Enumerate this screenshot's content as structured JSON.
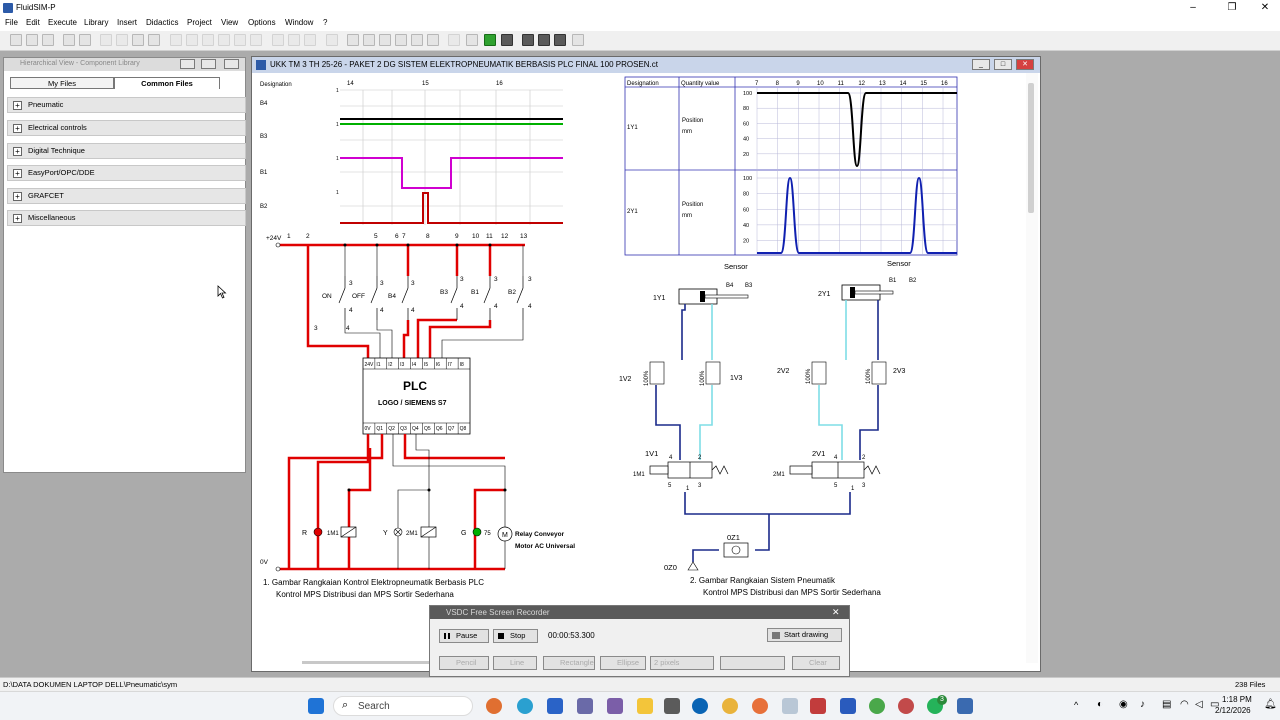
{
  "app": {
    "title": "FluidSIM-P",
    "minimize": "–",
    "maximize": "❐",
    "close": "✕"
  },
  "menu": [
    "File",
    "Edit",
    "Execute",
    "Library",
    "Insert",
    "Didactics",
    "Project",
    "View",
    "Options",
    "Window",
    "?"
  ],
  "library": {
    "title": "Hierarchical View - Component Library",
    "tabs": [
      "My Files",
      "Common Files"
    ],
    "items": [
      "Pneumatic",
      "Electrical controls",
      "Digital Technique",
      "EasyPort/OPC/DDE",
      "GRAFCET",
      "Miscellaneous"
    ]
  },
  "document": {
    "title": "UKK TM 3 TH 25-26 - PAKET 2 DG SISTEM ELEKTROPNEUMATIK BERBASIS PLC FINAL 100 PROSEN.ct"
  },
  "timing_diagram": {
    "header": "Designation",
    "ticks": [
      "14",
      "15",
      "16"
    ],
    "rows": [
      "B4",
      "B3",
      "B1",
      "B2"
    ],
    "one_label": "1",
    "colors": {
      "B4": "#000000",
      "B3": "#00b000",
      "B1": "#d000d0",
      "B2": "#c00000"
    }
  },
  "state_diagram": {
    "col_designation": "Designation",
    "col_quantity": "Quantity value",
    "ticks": [
      "7",
      "8",
      "9",
      "10",
      "11",
      "12",
      "13",
      "14",
      "15",
      "16"
    ],
    "rows": [
      {
        "name": "1Y1",
        "quantity": "Position",
        "unit": "mm"
      },
      {
        "name": "2Y1",
        "quantity": "Position",
        "unit": "mm"
      }
    ],
    "yticks": [
      "100",
      "80",
      "60",
      "40",
      "20"
    ]
  },
  "electrical": {
    "supply_top": "+24V",
    "supply_bottom": "0V",
    "line_numbers": [
      "1",
      "2",
      "5",
      "6",
      "7",
      "8",
      "9",
      "10",
      "11",
      "12",
      "13"
    ],
    "switches": [
      "ON",
      "OFF",
      "B4",
      "B3",
      "B1",
      "B2"
    ],
    "contact_numbers": {
      "a": "3",
      "b": "4"
    },
    "plc_title": "PLC",
    "plc_subtitle": "LOGO / SIEMENS S7",
    "inputs": [
      "24V",
      "I1",
      "I2",
      "I3",
      "I4",
      "I5",
      "I6",
      "I7",
      "I8"
    ],
    "outputs": [
      "0V",
      "Q1",
      "Q2",
      "Q3",
      "Q4",
      "Q5",
      "Q6",
      "Q7",
      "Q8"
    ],
    "loads": [
      "R",
      "1M1",
      "Y",
      "2M1",
      "G",
      "75"
    ],
    "motor_label1": "Relay Conveyor",
    "motor_label2": "Motor AC Universal",
    "motor_symbol": "M",
    "caption1": "1.  Gambar Rangkaian Kontrol Elektropneumatik Berbasis PLC",
    "caption2": "Kontrol MPS Distribusi dan MPS Sortir Sederhana"
  },
  "pneumatic": {
    "sensor_label": "Sensor",
    "cyl1": "1Y1",
    "cyl2": "2Y1",
    "cyl1_sensors": [
      "B4",
      "B3"
    ],
    "cyl2_sensors": [
      "B1",
      "B2"
    ],
    "throttles": [
      "1V2",
      "1V3",
      "2V2",
      "2V3"
    ],
    "throttle_pct": "100%",
    "valves": [
      "1V1",
      "2V1"
    ],
    "solenoids": [
      "1M1",
      "2M1"
    ],
    "ports": [
      "4",
      "2",
      "5",
      "1",
      "3"
    ],
    "service_unit": "0Z1",
    "source": "0Z0",
    "caption1": "2.  Gambar Rangkaian Sistem Pneumatik",
    "caption2": "Kontrol MPS Distribusi dan MPS Sortir Sederhana"
  },
  "recorder": {
    "title": "VSDC Free Screen Recorder",
    "pause": "Pause",
    "stop": "Stop",
    "time": "00:00:53.300",
    "start_drawing": "Start drawing",
    "pencil": "Pencil",
    "line": "Line",
    "rectangle": "Rectangle",
    "ellipse": "Ellipse",
    "pixels": "2 pixels",
    "clear": "Clear"
  },
  "statusbar": {
    "path": "D:\\DATA DOKUMEN LAPTOP DELL\\Pneumatic\\sym",
    "count": "238 Files"
  },
  "taskbar": {
    "search": "Search",
    "time": "1:18 PM",
    "date": "2/12/2026",
    "badge": "3"
  }
}
